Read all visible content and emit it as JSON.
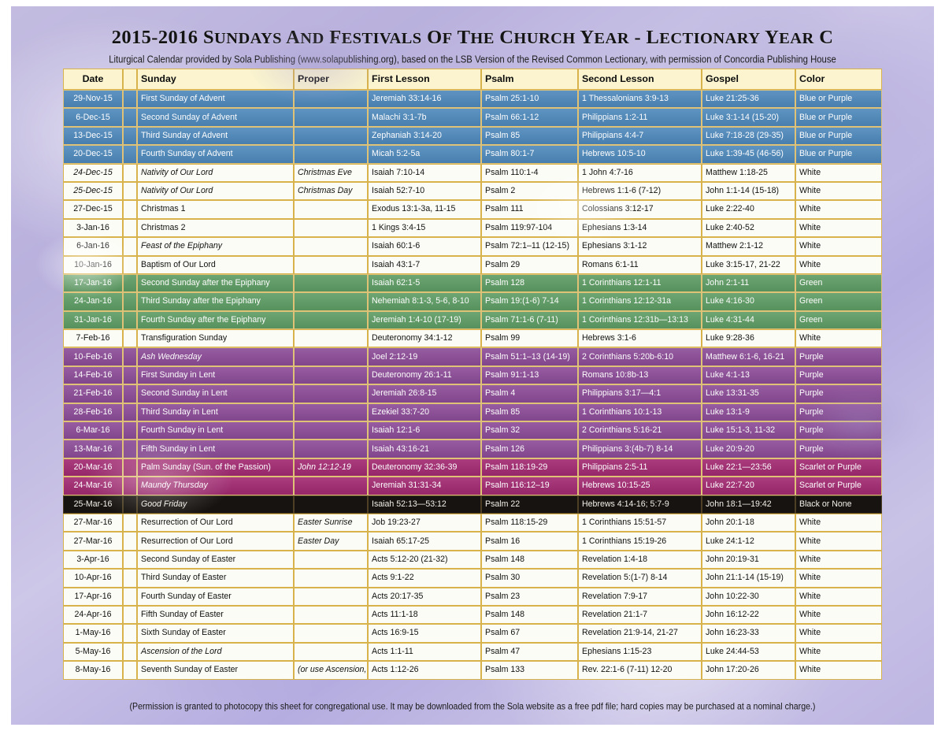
{
  "header": {
    "title_prefix": "2015-2016 ",
    "title": "2015-2016 SUNDAYS AND FESTIVALS OF THE CHURCH YEAR - LECTIONARY YEAR C",
    "subtitle": "Liturgical Calendar provided by Sola Publishing (www.solapublishing.org), based on the LSB Version of the Revised Common Lectionary, with permission of Concordia Publishing House"
  },
  "table": {
    "columns": [
      "Date",
      "",
      "Sunday",
      "Proper",
      "First Lesson",
      "Psalm",
      "Second Lesson",
      "Gospel",
      "Color"
    ],
    "rows": [
      {
        "season": "blue",
        "date": "29-Nov-15",
        "sunday": "First Sunday of Advent",
        "proper": "",
        "first": "Jeremiah 33:14-16",
        "psalm": "Psalm 25:1-10",
        "second": "1 Thessalonians 3:9-13",
        "gospel": "Luke 21:25-36",
        "color": "Blue or Purple",
        "italic_sunday": false,
        "italic_proper": false
      },
      {
        "season": "blue",
        "date": "6-Dec-15",
        "sunday": "Second Sunday of Advent",
        "proper": "",
        "first": "Malachi 3:1-7b",
        "psalm": "Psalm 66:1-12",
        "second": "Philippians 1:2-11",
        "gospel": "Luke 3:1-14 (15-20)",
        "color": "Blue or Purple",
        "italic_sunday": false,
        "italic_proper": false
      },
      {
        "season": "blue",
        "date": "13-Dec-15",
        "sunday": "Third Sunday of Advent",
        "proper": "",
        "first": "Zephaniah 3:14-20",
        "psalm": "Psalm 85",
        "second": "Philippians 4:4-7",
        "gospel": "Luke 7:18-28 (29-35)",
        "color": "Blue or Purple",
        "italic_sunday": false,
        "italic_proper": false
      },
      {
        "season": "blue",
        "date": "20-Dec-15",
        "sunday": "Fourth Sunday of Advent",
        "proper": "",
        "first": "Micah 5:2-5a",
        "psalm": "Psalm 80:1-7",
        "second": "Hebrews 10:5-10",
        "gospel": "Luke 1:39-45 (46-56)",
        "color": "Blue or Purple",
        "italic_sunday": false,
        "italic_proper": false
      },
      {
        "season": "white",
        "date": "24-Dec-15",
        "sunday": "Nativity of Our Lord",
        "proper": "Christmas Eve",
        "first": "Isaiah 7:10-14",
        "psalm": "Psalm 110:1-4",
        "second": "1 John 4:7-16",
        "gospel": "Matthew 1:18-25",
        "color": "White",
        "italic_sunday": true,
        "italic_proper": true,
        "italic_date": true
      },
      {
        "season": "white",
        "date": "25-Dec-15",
        "sunday": "Nativity of Our Lord",
        "proper": "Christmas Day",
        "first": "Isaiah 52:7-10",
        "psalm": "Psalm 2",
        "second": "Hebrews 1:1-6 (7-12)",
        "gospel": "John 1:1-14 (15-18)",
        "color": "White",
        "italic_sunday": true,
        "italic_proper": true,
        "italic_date": true
      },
      {
        "season": "white",
        "date": "27-Dec-15",
        "sunday": "Christmas 1",
        "proper": "",
        "first": "Exodus 13:1-3a, 11-15",
        "psalm": "Psalm 111",
        "second": "Colossians 3:12-17",
        "gospel": "Luke 2:22-40",
        "color": "White",
        "italic_sunday": false,
        "italic_proper": false
      },
      {
        "season": "white",
        "date": "3-Jan-16",
        "sunday": "Christmas 2",
        "proper": "",
        "first": "1 Kings 3:4-15",
        "psalm": "Psalm 119:97-104",
        "second": "Ephesians 1:3-14",
        "gospel": "Luke 2:40-52",
        "color": "White",
        "italic_sunday": false,
        "italic_proper": false
      },
      {
        "season": "white",
        "date": "6-Jan-16",
        "sunday": "Feast of the Epiphany",
        "proper": "",
        "first": "Isaiah 60:1-6",
        "psalm": "Psalm 72:1–11 (12-15)",
        "second": "Ephesians 3:1-12",
        "gospel": "Matthew 2:1-12",
        "color": "White",
        "italic_sunday": true,
        "italic_proper": false
      },
      {
        "season": "white",
        "date": "10-Jan-16",
        "sunday": "Baptism of Our Lord",
        "proper": "",
        "first": "Isaiah 43:1-7",
        "psalm": "Psalm 29",
        "second": "Romans 6:1-11",
        "gospel": "Luke 3:15-17, 21-22",
        "color": "White",
        "italic_sunday": false,
        "italic_proper": false
      },
      {
        "season": "green",
        "date": "17-Jan-16",
        "sunday": "Second Sunday after the Epiphany",
        "proper": "",
        "first": "Isaiah 62:1-5",
        "psalm": "Psalm 128",
        "second": "1 Corinthians 12:1-11",
        "gospel": "John 2:1-11",
        "color": "Green",
        "italic_sunday": false,
        "italic_proper": false
      },
      {
        "season": "green",
        "date": "24-Jan-16",
        "sunday": "Third Sunday after the Epiphany",
        "proper": "",
        "first": "Nehemiah 8:1-3, 5-6, 8-10",
        "psalm": "Psalm 19:(1-6) 7-14",
        "second": "1 Corinthians 12:12-31a",
        "gospel": "Luke 4:16-30",
        "color": "Green",
        "italic_sunday": false,
        "italic_proper": false
      },
      {
        "season": "green",
        "date": "31-Jan-16",
        "sunday": "Fourth Sunday after the Epiphany",
        "proper": "",
        "first": "Jeremiah 1:4-10 (17-19)",
        "psalm": "Psalm 71:1-6 (7-11)",
        "second": "1 Corinthians 12:31b—13:13",
        "gospel": "Luke 4:31-44",
        "color": "Green",
        "italic_sunday": false,
        "italic_proper": false
      },
      {
        "season": "white",
        "date": "7-Feb-16",
        "sunday": "Transfiguration Sunday",
        "proper": "",
        "first": "Deuteronomy 34:1-12",
        "psalm": "Psalm 99",
        "second": "Hebrews 3:1-6",
        "gospel": "Luke 9:28-36",
        "color": "White",
        "italic_sunday": false,
        "italic_proper": false
      },
      {
        "season": "purple",
        "date": "10-Feb-16",
        "sunday": "Ash Wednesday",
        "proper": "",
        "first": "Joel 2:12-19",
        "psalm": "Psalm 51:1–13 (14-19)",
        "second": "2 Corinthians 5:20b-6:10",
        "gospel": "Matthew 6:1-6, 16-21",
        "color": "Purple",
        "italic_sunday": true,
        "italic_proper": false
      },
      {
        "season": "purple",
        "date": "14-Feb-16",
        "sunday": "First Sunday in Lent",
        "proper": "",
        "first": "Deuteronomy 26:1-11",
        "psalm": "Psalm 91:1-13",
        "second": "Romans 10:8b-13",
        "gospel": "Luke 4:1-13",
        "color": "Purple",
        "italic_sunday": false,
        "italic_proper": false
      },
      {
        "season": "purple",
        "date": "21-Feb-16",
        "sunday": "Second Sunday in Lent",
        "proper": "",
        "first": "Jeremiah 26:8-15",
        "psalm": "Psalm 4",
        "second": "Philippians 3:17—4:1",
        "gospel": "Luke 13:31-35",
        "color": "Purple",
        "italic_sunday": false,
        "italic_proper": false
      },
      {
        "season": "purple",
        "date": "28-Feb-16",
        "sunday": "Third Sunday in Lent",
        "proper": "",
        "first": "Ezekiel 33:7-20",
        "psalm": "Psalm 85",
        "second": "1 Corinthians 10:1-13",
        "gospel": "Luke 13:1-9",
        "color": "Purple",
        "italic_sunday": false,
        "italic_proper": false
      },
      {
        "season": "purple",
        "date": "6-Mar-16",
        "sunday": "Fourth Sunday in Lent",
        "proper": "",
        "first": "Isaiah 12:1-6",
        "psalm": "Psalm 32",
        "second": "2 Corinthians 5:16-21",
        "gospel": "Luke 15:1-3, 11-32",
        "color": "Purple",
        "italic_sunday": false,
        "italic_proper": false
      },
      {
        "season": "purple",
        "date": "13-Mar-16",
        "sunday": "Fifth Sunday in Lent",
        "proper": "",
        "first": "Isaiah 43:16-21",
        "psalm": "Psalm 126",
        "second": "Philippians 3:(4b-7) 8-14",
        "gospel": "Luke 20:9-20",
        "color": "Purple",
        "italic_sunday": false,
        "italic_proper": false
      },
      {
        "season": "scarlet",
        "date": "20-Mar-16",
        "sunday": "Palm Sunday (Sun. of the Passion)",
        "proper": "John 12:12-19",
        "first": "Deuteronomy 32:36-39",
        "psalm": "Psalm 118:19-29",
        "second": "Philippians 2:5-11",
        "gospel": "Luke 22:1—23:56",
        "color": "Scarlet or Purple",
        "italic_sunday": false,
        "italic_proper": true
      },
      {
        "season": "scarlet",
        "date": "24-Mar-16",
        "sunday": "Maundy Thursday",
        "proper": "",
        "first": "Jeremiah 31:31-34",
        "psalm": "Psalm 116:12–19",
        "second": "Hebrews 10:15-25",
        "gospel": "Luke 22:7-20",
        "color": "Scarlet or Purple",
        "italic_sunday": true,
        "italic_proper": false
      },
      {
        "season": "black",
        "date": "25-Mar-16",
        "sunday": "Good Friday",
        "proper": "",
        "first": "Isaiah 52:13—53:12",
        "psalm": "Psalm 22",
        "second": "Hebrews 4:14-16; 5:7-9",
        "gospel": "John 18:1—19:42",
        "color": "Black or None",
        "italic_sunday": true,
        "italic_proper": false
      },
      {
        "season": "white",
        "date": "27-Mar-16",
        "sunday": "Resurrection of Our Lord",
        "proper": "Easter Sunrise",
        "first": "Job 19:23-27",
        "psalm": "Psalm 118:15-29",
        "second": "1 Corinthians 15:51-57",
        "gospel": "John 20:1-18",
        "color": "White",
        "italic_sunday": false,
        "italic_proper": true
      },
      {
        "season": "white",
        "date": "27-Mar-16",
        "sunday": "Resurrection of Our Lord",
        "proper": "Easter Day",
        "first": "Isaiah 65:17-25",
        "psalm": "Psalm 16",
        "second": "1 Corinthians 15:19-26",
        "gospel": "Luke 24:1-12",
        "color": "White",
        "italic_sunday": false,
        "italic_proper": true
      },
      {
        "season": "white",
        "date": "3-Apr-16",
        "sunday": "Second Sunday of Easter",
        "proper": "",
        "first": "Acts 5:12-20 (21-32)",
        "psalm": "Psalm 148",
        "second": "Revelation 1:4-18",
        "gospel": "John 20:19-31",
        "color": "White",
        "italic_sunday": false,
        "italic_proper": false
      },
      {
        "season": "white",
        "date": "10-Apr-16",
        "sunday": "Third Sunday of Easter",
        "proper": "",
        "first": "Acts 9:1-22",
        "psalm": "Psalm 30",
        "second": "Revelation 5:(1-7) 8-14",
        "gospel": "John 21:1-14 (15-19)",
        "color": "White",
        "italic_sunday": false,
        "italic_proper": false
      },
      {
        "season": "white",
        "date": "17-Apr-16",
        "sunday": "Fourth Sunday of Easter",
        "proper": "",
        "first": "Acts 20:17-35",
        "psalm": "Psalm 23",
        "second": "Revelation 7:9-17",
        "gospel": "John 10:22-30",
        "color": "White",
        "italic_sunday": false,
        "italic_proper": false
      },
      {
        "season": "white",
        "date": "24-Apr-16",
        "sunday": "Fifth Sunday of Easter",
        "proper": "",
        "first": "Acts 11:1-18",
        "psalm": "Psalm 148",
        "second": "Revelation 21:1-7",
        "gospel": "John 16:12-22",
        "color": "White",
        "italic_sunday": false,
        "italic_proper": false
      },
      {
        "season": "white",
        "date": "1-May-16",
        "sunday": "Sixth Sunday of Easter",
        "proper": "",
        "first": "Acts 16:9-15",
        "psalm": "Psalm 67",
        "second": "Revelation 21:9-14, 21-27",
        "gospel": "John 16:23-33",
        "color": "White",
        "italic_sunday": false,
        "italic_proper": false
      },
      {
        "season": "white",
        "date": "5-May-16",
        "sunday": "Ascension of the Lord",
        "proper": "",
        "first": "Acts 1:1-11",
        "psalm": "Psalm 47",
        "second": "Ephesians 1:15-23",
        "gospel": "Luke 24:44-53",
        "color": "White",
        "italic_sunday": true,
        "italic_proper": false
      },
      {
        "season": "white",
        "date": "8-May-16",
        "sunday": "Seventh Sunday of Easter",
        "proper": "(or use Ascension,",
        "first": "Acts 1:12-26",
        "psalm": "Psalm 133",
        "second": "Rev. 22:1-6 (7-11) 12-20",
        "gospel": "John 17:20-26",
        "color": "White",
        "italic_sunday": false,
        "italic_proper": true
      }
    ]
  },
  "footer": {
    "note": "(Permission is granted to photocopy this sheet for congregational use. It may be downloaded from the Sola website as a free pdf file; hard copies may be purchased at a nominal charge.)"
  },
  "colors": {
    "advent_blue": "#4d88bb",
    "epiphany_green": "#5d9c63",
    "lent_purple": "#8c4c97",
    "passion_scarlet": "#a22a72",
    "good_friday_black": "#171310",
    "festival_white": "#fcfcf7",
    "header_cream": "#fbf4cf",
    "grid_gold": "#d8b24a",
    "page_lavender": "#c0b8e3"
  }
}
